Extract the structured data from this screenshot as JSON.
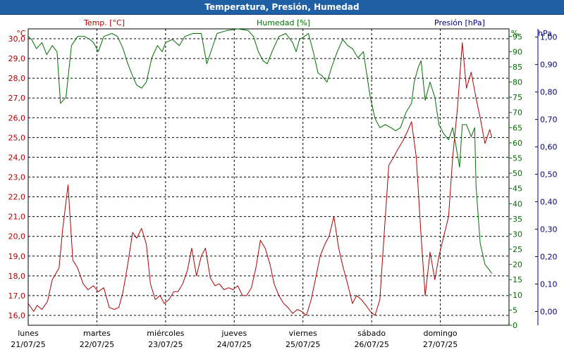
{
  "window": {
    "title": "Temperatura, Presión, Humedad"
  },
  "colors": {
    "temperature": "#b00000",
    "humidity": "#007000",
    "pressure": "#000080",
    "title_bar": "#1f5fa3"
  },
  "chart_data": {
    "type": "line",
    "title": "Temperatura, Presión, Humedad",
    "grid": true,
    "legend": "top",
    "axes": {
      "temperature": {
        "label": "Temp. [°C]",
        "unit": "°C",
        "ylim": [
          15.5,
          30.5
        ],
        "ticks": [
          "16,0",
          "17,0",
          "18,0",
          "19,0",
          "20,0",
          "21,0",
          "22,0",
          "23,0",
          "24,0",
          "25,0",
          "26,0",
          "27,0",
          "28,0",
          "29,0",
          "30,0"
        ]
      },
      "humidity": {
        "label": "Humedad [%]",
        "unit": "%",
        "ylim": [
          0,
          97.5
        ],
        "ticks": [
          "0",
          "5",
          "10",
          "15",
          "20",
          "25",
          "30",
          "35",
          "40",
          "45",
          "50",
          "55",
          "60",
          "65",
          "70",
          "75",
          "80",
          "85",
          "90",
          "95"
        ]
      },
      "pressure": {
        "label": "Presión [hPa]",
        "unit": "hPa",
        "ylim": [
          -0.05,
          1.03
        ],
        "ticks": [
          "0,00",
          "0,10",
          "0,20",
          "0,30",
          "0,40",
          "0,50",
          "0,60",
          "0,70",
          "0,80",
          "0,90",
          "1,00"
        ]
      },
      "x": {
        "range": [
          0,
          7
        ],
        "day_labels": [
          {
            "day": "lunes",
            "date": "21/07/25"
          },
          {
            "day": "martes",
            "date": "22/07/25"
          },
          {
            "day": "miércoles",
            "date": "23/07/25"
          },
          {
            "day": "jueves",
            "date": "24/07/25"
          },
          {
            "day": "viernes",
            "date": "25/07/25"
          },
          {
            "day": "sábado",
            "date": "26/07/25"
          },
          {
            "day": "domingo",
            "date": "27/07/25"
          }
        ]
      }
    },
    "series": [
      {
        "name": "Temp. [°C]",
        "axis": "temperature",
        "points": [
          [
            0,
            16.6
          ],
          [
            0.08,
            16.2
          ],
          [
            0.13,
            16.5
          ],
          [
            0.2,
            16.3
          ],
          [
            0.28,
            16.7
          ],
          [
            0.35,
            17.8
          ],
          [
            0.45,
            18.4
          ],
          [
            0.5,
            20.3
          ],
          [
            0.58,
            22.6
          ],
          [
            0.65,
            18.8
          ],
          [
            0.72,
            18.4
          ],
          [
            0.8,
            17.6
          ],
          [
            0.87,
            17.3
          ],
          [
            0.95,
            17.5
          ],
          [
            1.02,
            17.2
          ],
          [
            1.1,
            17.4
          ],
          [
            1.18,
            16.4
          ],
          [
            1.25,
            16.3
          ],
          [
            1.32,
            16.4
          ],
          [
            1.38,
            17.2
          ],
          [
            1.45,
            18.6
          ],
          [
            1.52,
            20.2
          ],
          [
            1.58,
            19.9
          ],
          [
            1.65,
            20.4
          ],
          [
            1.72,
            19.6
          ],
          [
            1.78,
            17.6
          ],
          [
            1.85,
            16.8
          ],
          [
            1.92,
            17.0
          ],
          [
            1.98,
            16.6
          ],
          [
            2.05,
            16.8
          ],
          [
            2.12,
            17.2
          ],
          [
            2.18,
            17.2
          ],
          [
            2.25,
            17.6
          ],
          [
            2.32,
            18.3
          ],
          [
            2.38,
            19.4
          ],
          [
            2.45,
            18.0
          ],
          [
            2.52,
            19.0
          ],
          [
            2.58,
            19.4
          ],
          [
            2.65,
            17.9
          ],
          [
            2.72,
            17.5
          ],
          [
            2.78,
            17.6
          ],
          [
            2.85,
            17.3
          ],
          [
            2.92,
            17.4
          ],
          [
            2.98,
            17.3
          ],
          [
            3.05,
            17.5
          ],
          [
            3.12,
            17.0
          ],
          [
            3.18,
            17.0
          ],
          [
            3.25,
            17.4
          ],
          [
            3.32,
            18.5
          ],
          [
            3.38,
            19.8
          ],
          [
            3.45,
            19.4
          ],
          [
            3.52,
            18.6
          ],
          [
            3.58,
            17.6
          ],
          [
            3.65,
            17.0
          ],
          [
            3.72,
            16.6
          ],
          [
            3.78,
            16.4
          ],
          [
            3.85,
            16.1
          ],
          [
            3.92,
            16.3
          ],
          [
            3.98,
            16.2
          ],
          [
            4.05,
            16.0
          ],
          [
            4.12,
            16.8
          ],
          [
            4.18,
            17.8
          ],
          [
            4.25,
            19.0
          ],
          [
            4.32,
            19.6
          ],
          [
            4.38,
            20.0
          ],
          [
            4.45,
            21.0
          ],
          [
            4.52,
            19.4
          ],
          [
            4.58,
            18.5
          ],
          [
            4.65,
            17.6
          ],
          [
            4.72,
            16.6
          ],
          [
            4.78,
            17.0
          ],
          [
            4.85,
            16.8
          ],
          [
            4.92,
            16.5
          ],
          [
            4.98,
            16.2
          ],
          [
            5.05,
            16.0
          ],
          [
            5.12,
            16.8
          ],
          [
            5.18,
            20.0
          ],
          [
            5.25,
            23.6
          ],
          [
            5.32,
            24.0
          ],
          [
            5.38,
            24.4
          ],
          [
            5.45,
            24.8
          ],
          [
            5.52,
            25.3
          ],
          [
            5.58,
            25.8
          ],
          [
            5.65,
            24.0
          ],
          [
            5.72,
            20.0
          ],
          [
            5.78,
            17.0
          ],
          [
            5.85,
            19.2
          ],
          [
            5.92,
            17.8
          ],
          [
            5.98,
            19.0
          ],
          [
            6.05,
            20.0
          ],
          [
            6.12,
            21.0
          ],
          [
            6.18,
            24.0
          ],
          [
            6.25,
            26.5
          ],
          [
            6.32,
            29.8
          ],
          [
            6.38,
            27.5
          ],
          [
            6.45,
            28.3
          ],
          [
            6.52,
            27.0
          ],
          [
            6.58,
            26.0
          ],
          [
            6.65,
            24.7
          ],
          [
            6.72,
            25.4
          ],
          [
            6.75,
            25.0
          ]
        ]
      },
      {
        "name": "Humedad [%]",
        "axis": "humidity",
        "points": [
          [
            0,
            95
          ],
          [
            0.05,
            94
          ],
          [
            0.12,
            91
          ],
          [
            0.2,
            93
          ],
          [
            0.27,
            89
          ],
          [
            0.35,
            92
          ],
          [
            0.42,
            90
          ],
          [
            0.47,
            73
          ],
          [
            0.55,
            75
          ],
          [
            0.63,
            92
          ],
          [
            0.72,
            95
          ],
          [
            0.82,
            95
          ],
          [
            0.9,
            94
          ],
          [
            0.95,
            93
          ],
          [
            1.02,
            90
          ],
          [
            1.1,
            95
          ],
          [
            1.22,
            96
          ],
          [
            1.3,
            95
          ],
          [
            1.38,
            91
          ],
          [
            1.45,
            86
          ],
          [
            1.52,
            82
          ],
          [
            1.58,
            79
          ],
          [
            1.65,
            78
          ],
          [
            1.72,
            80
          ],
          [
            1.8,
            88
          ],
          [
            1.88,
            92
          ],
          [
            1.95,
            90
          ],
          [
            2.0,
            93
          ],
          [
            2.1,
            94
          ],
          [
            2.2,
            92
          ],
          [
            2.28,
            95
          ],
          [
            2.4,
            96
          ],
          [
            2.52,
            96
          ],
          [
            2.6,
            86
          ],
          [
            2.66,
            90
          ],
          [
            2.75,
            96
          ],
          [
            2.9,
            97
          ],
          [
            3.05,
            97.5
          ],
          [
            3.2,
            97
          ],
          [
            3.28,
            95
          ],
          [
            3.35,
            90
          ],
          [
            3.42,
            87
          ],
          [
            3.48,
            86
          ],
          [
            3.55,
            90
          ],
          [
            3.65,
            95
          ],
          [
            3.75,
            96
          ],
          [
            3.85,
            93
          ],
          [
            3.9,
            90
          ],
          [
            3.95,
            94
          ],
          [
            4.02,
            95
          ],
          [
            4.08,
            96
          ],
          [
            4.15,
            90
          ],
          [
            4.22,
            83
          ],
          [
            4.28,
            82
          ],
          [
            4.35,
            80
          ],
          [
            4.42,
            85
          ],
          [
            4.5,
            90
          ],
          [
            4.58,
            94
          ],
          [
            4.65,
            92
          ],
          [
            4.72,
            91
          ],
          [
            4.8,
            88
          ],
          [
            4.88,
            90
          ],
          [
            4.92,
            84
          ],
          [
            4.98,
            75
          ],
          [
            5.05,
            68
          ],
          [
            5.12,
            65
          ],
          [
            5.2,
            66
          ],
          [
            5.28,
            65
          ],
          [
            5.35,
            64
          ],
          [
            5.42,
            65
          ],
          [
            5.5,
            70
          ],
          [
            5.58,
            73
          ],
          [
            5.62,
            80
          ],
          [
            5.68,
            85
          ],
          [
            5.72,
            87
          ],
          [
            5.78,
            74
          ],
          [
            5.85,
            80
          ],
          [
            5.92,
            75
          ],
          [
            5.98,
            66
          ],
          [
            6.05,
            63
          ],
          [
            6.12,
            61
          ],
          [
            6.18,
            65
          ],
          [
            6.22,
            60
          ],
          [
            6.28,
            52
          ],
          [
            6.32,
            66
          ],
          [
            6.38,
            66
          ],
          [
            6.45,
            62
          ],
          [
            6.5,
            65
          ],
          [
            6.52,
            46
          ],
          [
            6.58,
            27
          ],
          [
            6.65,
            20
          ],
          [
            6.72,
            18
          ],
          [
            6.75,
            17
          ]
        ]
      },
      {
        "name": "Presión [hPa]",
        "axis": "pressure",
        "points": []
      }
    ]
  }
}
